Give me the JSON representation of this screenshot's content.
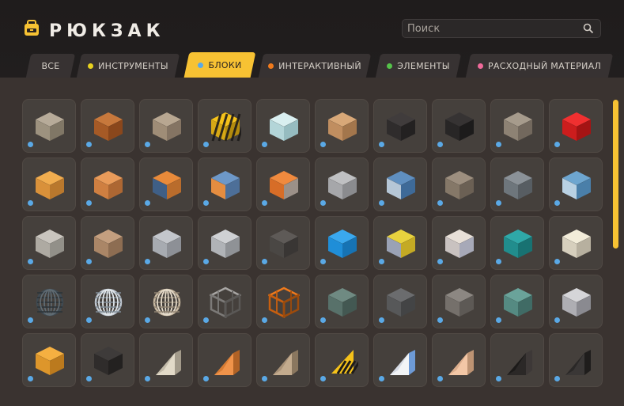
{
  "app": {
    "title": "РЮКЗАК"
  },
  "search": {
    "placeholder": "Поиск"
  },
  "tabs": [
    {
      "label": "ВСЕ",
      "dot": null,
      "active": false
    },
    {
      "label": "ИНСТРУМЕНТЫ",
      "dot": "#e8d21f",
      "active": false
    },
    {
      "label": "БЛОКИ",
      "dot": "#5aa9e6",
      "active": true
    },
    {
      "label": "ИНТЕРАКТИВНЫЙ",
      "dot": "#f07a1c",
      "active": false
    },
    {
      "label": "ЭЛЕМЕНТЫ",
      "dot": "#55c24a",
      "active": false
    },
    {
      "label": "РАСХОДНЫЙ МАТЕРИАЛ",
      "dot": "#f06a9a",
      "active": false
    }
  ],
  "colors": {
    "accent": "#f7c233",
    "badge": "#5aa9e6"
  },
  "grid": {
    "rows": [
      [
        {
          "icon": "stone-block-icon",
          "kind": "cube",
          "c": [
            "#b7ab99",
            "#9d927f",
            "#807766"
          ]
        },
        {
          "icon": "brick-block-icon",
          "kind": "cube",
          "c": [
            "#c7783c",
            "#a65a26",
            "#8a471c"
          ]
        },
        {
          "icon": "sandstone-block-icon",
          "kind": "cube",
          "c": [
            "#b8a791",
            "#9f8d77",
            "#847463"
          ]
        },
        {
          "icon": "hazard-stripe-block-icon",
          "kind": "hazard",
          "c": [
            "#f5c21a",
            "#d7a815",
            "#b38b0e"
          ]
        },
        {
          "icon": "ice-block-icon",
          "kind": "cube",
          "c": [
            "#d9eff0",
            "#b3d5d8",
            "#96bcc0"
          ]
        },
        {
          "icon": "wood-plank-block-icon",
          "kind": "cube",
          "c": [
            "#d8a878",
            "#c08e60",
            "#a3764c"
          ]
        },
        {
          "icon": "dark-block-icon",
          "kind": "cube",
          "c": [
            "#403c3c",
            "#2f2c2c",
            "#232121"
          ]
        },
        {
          "icon": "black-tile-block-icon",
          "kind": "cube",
          "c": [
            "#363333",
            "#282626",
            "#1c1b1b"
          ]
        },
        {
          "icon": "speckled-block-icon",
          "kind": "cube",
          "c": [
            "#a69b8c",
            "#8d8274",
            "#72685d"
          ]
        },
        {
          "icon": "red-block-icon",
          "kind": "cube",
          "c": [
            "#f03030",
            "#cc1d1d",
            "#a41414"
          ]
        }
      ],
      [
        {
          "icon": "wood-block-icon",
          "kind": "cube",
          "c": [
            "#f1ad4f",
            "#d9913a",
            "#b9782d"
          ]
        },
        {
          "icon": "orange-tile-block-icon",
          "kind": "cube",
          "c": [
            "#e99b5a",
            "#cf7f41",
            "#ad6733"
          ]
        },
        {
          "icon": "metal-orange-block-icon",
          "kind": "cube",
          "c": [
            "#e88a3a",
            "#3f5f86",
            "#b96c2c"
          ]
        },
        {
          "icon": "blue-orange-block-icon",
          "kind": "cube",
          "c": [
            "#6d98c8",
            "#e58d40",
            "#4d6f98"
          ]
        },
        {
          "icon": "orange-metal-block-icon",
          "kind": "cube",
          "c": [
            "#f08a3e",
            "#d76d27",
            "#9b9088"
          ]
        },
        {
          "icon": "grey-tile-block-icon",
          "kind": "cube",
          "c": [
            "#bfc0c2",
            "#a6a7aa",
            "#8a8b8e"
          ]
        },
        {
          "icon": "blue-pattern-block-icon",
          "kind": "cube",
          "c": [
            "#5f8fc0",
            "#b5c6d6",
            "#3e6a98"
          ]
        },
        {
          "icon": "taupe-block-icon",
          "kind": "cube",
          "c": [
            "#9d8f7f",
            "#857868",
            "#6b6054"
          ]
        },
        {
          "icon": "steel-block-icon",
          "kind": "cube",
          "c": [
            "#8b9298",
            "#6e767c",
            "#575d62"
          ]
        },
        {
          "icon": "blue-circuit-block-icon",
          "kind": "cube",
          "c": [
            "#6ea6d0",
            "#b9d1e3",
            "#4a7fa9"
          ]
        }
      ],
      [
        {
          "icon": "cracked-stone-block-icon",
          "kind": "cube",
          "c": [
            "#c9c5be",
            "#aeaaa2",
            "#929089"
          ]
        },
        {
          "icon": "tan-tile-block-icon",
          "kind": "cube",
          "c": [
            "#c49f7f",
            "#aa8667",
            "#8d6d52"
          ]
        },
        {
          "icon": "light-grey-block-icon",
          "kind": "cube",
          "c": [
            "#c3c6cb",
            "#a7abb1",
            "#8d9096"
          ]
        },
        {
          "icon": "silver-block-icon",
          "kind": "cube",
          "c": [
            "#cfd1d4",
            "#b0b3b7",
            "#8f9296"
          ]
        },
        {
          "icon": "dark-mesh-block-icon",
          "kind": "cube",
          "c": [
            "#5e5a57",
            "#4a4744",
            "#393634"
          ]
        },
        {
          "icon": "blue-block-icon",
          "kind": "cube",
          "c": [
            "#3aa8ee",
            "#1f8ed8",
            "#1673b4"
          ]
        },
        {
          "icon": "yellow-grey-block-icon",
          "kind": "cube",
          "c": [
            "#e8d23e",
            "#9aa2b5",
            "#c4aa24"
          ]
        },
        {
          "icon": "marble-block-icon",
          "kind": "cube",
          "c": [
            "#e8e0d8",
            "#c9c2c0",
            "#a7a9b8"
          ]
        },
        {
          "icon": "teal-block-icon",
          "kind": "cube",
          "c": [
            "#2fa8a8",
            "#218d8d",
            "#187272"
          ]
        },
        {
          "icon": "cream-block-icon",
          "kind": "cube",
          "c": [
            "#f2ecd9",
            "#d6cfbd",
            "#b7b09f"
          ]
        }
      ],
      [
        {
          "icon": "wire-sphere-icon",
          "kind": "sphere",
          "c": [
            "#3f4a52",
            "#2a3238",
            "#5f6b73"
          ]
        },
        {
          "icon": "lattice-sphere-icon",
          "kind": "sphere",
          "c": [
            "#bfc7d0",
            "#7f8b95",
            "#e0e6ea"
          ]
        },
        {
          "icon": "mesh-sphere-icon",
          "kind": "sphere",
          "c": [
            "#c8b9a2",
            "#8f8271",
            "#e6dccb"
          ]
        },
        {
          "icon": "frame-block-icon",
          "kind": "frame",
          "c": [
            "#a8a6a4",
            "#7c7a78",
            "#5a5856"
          ]
        },
        {
          "icon": "orange-frame-block-icon",
          "kind": "frame",
          "c": [
            "#f07a1c",
            "#c85f0f",
            "#9e4b0b"
          ]
        },
        {
          "icon": "green-stone-block-icon",
          "kind": "cube",
          "c": [
            "#6f8a82",
            "#58716a",
            "#435852"
          ]
        },
        {
          "icon": "slate-block-icon",
          "kind": "cube",
          "c": [
            "#6b6c6e",
            "#575859",
            "#434445"
          ]
        },
        {
          "icon": "grey-stone-block-icon",
          "kind": "cube",
          "c": [
            "#8c8782",
            "#75706b",
            "#5d5955"
          ]
        },
        {
          "icon": "moss-block-icon",
          "kind": "cube",
          "c": [
            "#6aa39a",
            "#558a82",
            "#406b65"
          ]
        },
        {
          "icon": "zigzag-block-icon",
          "kind": "cube",
          "c": [
            "#d5d5d8",
            "#aeaeb3",
            "#8a8a90"
          ]
        }
      ],
      [
        {
          "icon": "amber-block-icon",
          "kind": "cube",
          "c": [
            "#f5b041",
            "#dd962b",
            "#bb7a1e"
          ]
        },
        {
          "icon": "dark-grate-block-icon",
          "kind": "cube",
          "c": [
            "#3e3b3a",
            "#2f2c2b",
            "#232120"
          ]
        },
        {
          "icon": "sand-wedge-icon",
          "kind": "wedge",
          "c": [
            "#e2dac8",
            "#c3bba9",
            "#a39b8b"
          ]
        },
        {
          "icon": "orange-wedge-icon",
          "kind": "wedge",
          "c": [
            "#f0934a",
            "#d67b33",
            "#b06226"
          ]
        },
        {
          "icon": "tan-wedge-icon",
          "kind": "wedge",
          "c": [
            "#c3ab8e",
            "#a89177",
            "#8a775f"
          ]
        },
        {
          "icon": "hazard-wedge-icon",
          "kind": "hazardwedge",
          "c": [
            "#f5c21a",
            "#1d1b1a",
            "#b38b0e"
          ]
        },
        {
          "icon": "white-wedge-icon",
          "kind": "wedge",
          "c": [
            "#f2f4f6",
            "#d6dbe4",
            "#6d9ad6"
          ]
        },
        {
          "icon": "peach-wedge-icon",
          "kind": "wedge",
          "c": [
            "#f3c7a6",
            "#dcae8d",
            "#bd9373"
          ]
        },
        {
          "icon": "black-wedge-icon",
          "kind": "wedge",
          "c": [
            "#2b2827",
            "#1c1a19",
            "#3d3837"
          ]
        },
        {
          "icon": "dark-tile-wedge-icon",
          "kind": "wedge",
          "c": [
            "#3a3736",
            "#2a2827",
            "#1f1d1c"
          ]
        }
      ]
    ]
  }
}
